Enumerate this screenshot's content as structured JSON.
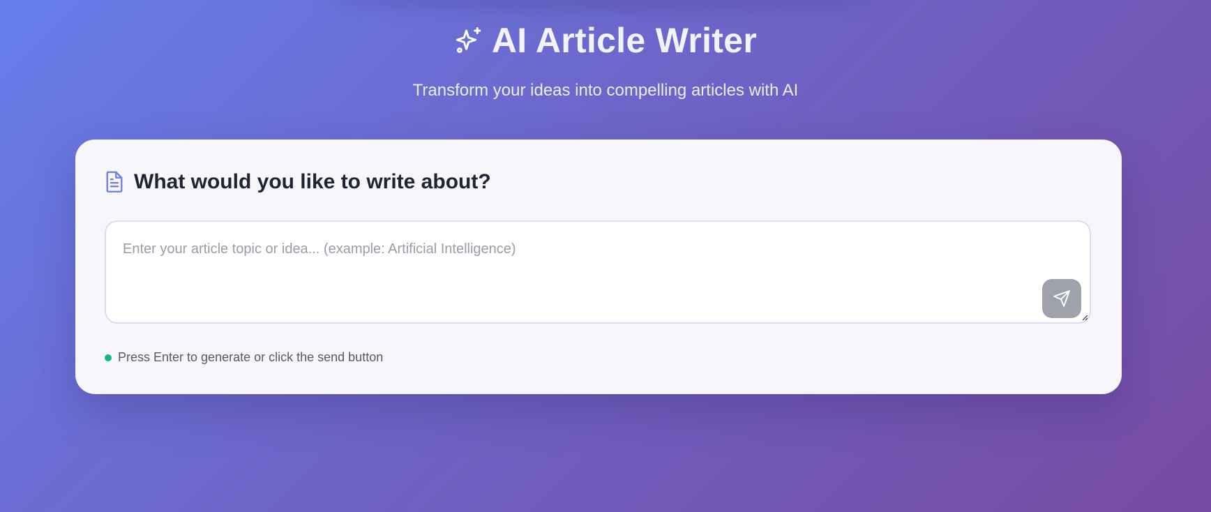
{
  "header": {
    "title": "AI Article Writer",
    "subtitle": "Transform your ideas into compelling articles with AI",
    "title_icon": "sparkles-icon"
  },
  "card": {
    "title": "What would you like to write about?",
    "title_icon": "document-icon",
    "input": {
      "value": "",
      "placeholder": "Enter your article topic or idea... (example: Artificial Intelligence)"
    },
    "send_icon": "send-icon",
    "hint": "Press Enter to generate or click the send button"
  },
  "colors": {
    "gradient_start": "#667eea",
    "gradient_end": "#764ba2",
    "accent": "#6b7ee6",
    "status_dot": "#10b981",
    "send_button": "#9fa2aa"
  }
}
